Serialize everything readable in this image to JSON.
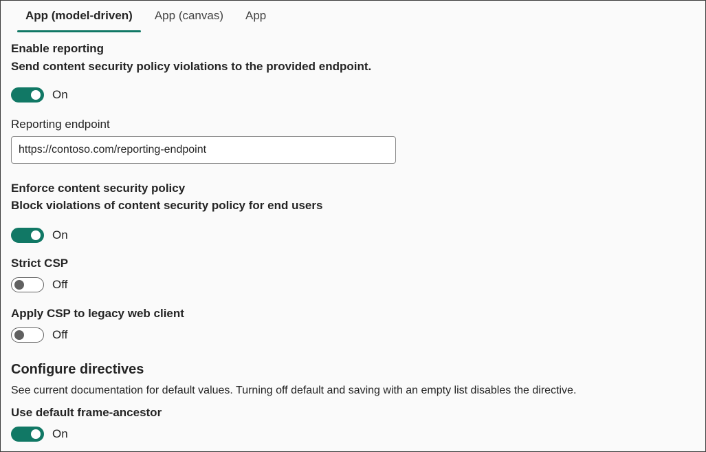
{
  "tabs": [
    {
      "label": "App (model-driven)",
      "selected": true
    },
    {
      "label": "App (canvas)",
      "selected": false
    },
    {
      "label": "App",
      "selected": false
    }
  ],
  "reporting": {
    "title": "Enable reporting",
    "description": "Send content security policy violations to the provided endpoint.",
    "toggle_state": "On",
    "endpoint_label": "Reporting endpoint",
    "endpoint_value": "https://contoso.com/reporting-endpoint"
  },
  "enforce": {
    "title": "Enforce content security policy",
    "description": "Block violations of content security policy for end users",
    "toggle_state": "On"
  },
  "strict_csp": {
    "title": "Strict CSP",
    "toggle_state": "Off"
  },
  "legacy_client": {
    "title": "Apply CSP to legacy web client",
    "toggle_state": "Off"
  },
  "directives": {
    "title": "Configure directives",
    "description": "See current documentation for default values. Turning off default and saving with an empty list disables the directive.",
    "frame_ancestor_title": "Use default frame-ancestor",
    "frame_ancestor_toggle_state": "On"
  },
  "colors": {
    "accent": "#117865",
    "toggle_off_border": "#616161",
    "text": "#242424",
    "background": "#fafafa"
  }
}
